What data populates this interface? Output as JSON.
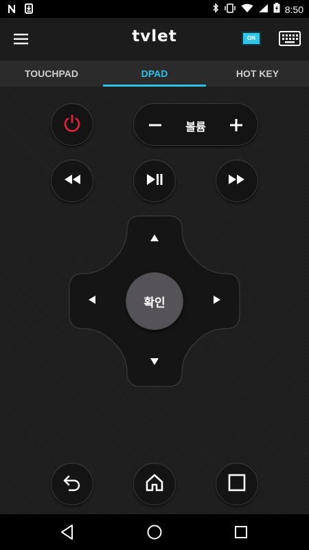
{
  "status_bar": {
    "time": "8:50",
    "left_icons": [
      "n-notification-icon",
      "download-icon"
    ],
    "right_icons": [
      "bluetooth-icon",
      "vibrate-icon",
      "wifi-icon",
      "signal-icon",
      "battery-icon"
    ]
  },
  "app_bar": {
    "title": "tvlet",
    "on_badge": "ON",
    "menu_icon": "hamburger-menu-icon",
    "keyboard_icon": "keyboard-icon"
  },
  "tabs": [
    {
      "label": "TOUCHPAD",
      "active": false
    },
    {
      "label": "DPAD",
      "active": true
    },
    {
      "label": "HOT KEY",
      "active": false
    }
  ],
  "controls": {
    "volume_label": "볼륨",
    "volume_minus": "−",
    "volume_plus": "+",
    "ok_label": "확인"
  },
  "colors": {
    "accent": "#2ec2e6",
    "power": "#e8213c",
    "background": "#1e1e1e",
    "ok_button": "#555357"
  }
}
